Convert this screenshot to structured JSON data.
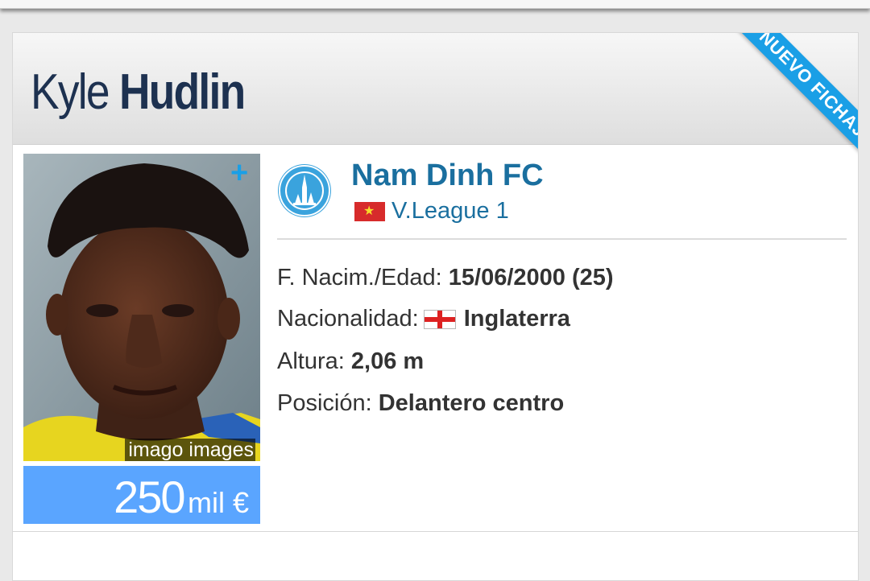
{
  "player": {
    "first_name": "Kyle",
    "last_name": "Hudlin",
    "badge": "NUEVO FICHAJE",
    "photo_credit": "imago images",
    "photo_plus": "+"
  },
  "market_value": {
    "amount": "250",
    "unit": "mil €"
  },
  "club": {
    "name": "Nam Dinh FC",
    "league": "V.League 1",
    "league_flag": "vietnam-flag-icon",
    "logo": "nam-dinh-crest-icon"
  },
  "details": [
    {
      "label": "F. Nacim./Edad:",
      "value": "15/06/2000 (25)"
    },
    {
      "label": "Nacionalidad:",
      "value": "Inglaterra",
      "flag": "england-flag-icon"
    },
    {
      "label": "Altura:",
      "value": "2,06 m"
    },
    {
      "label": "Posición:",
      "value": "Delantero centro"
    }
  ],
  "colors": {
    "accent": "#1a9fe6",
    "value_box": "#5aa5ff",
    "name_text": "#1d3150",
    "link_text": "#1a6f9f"
  }
}
